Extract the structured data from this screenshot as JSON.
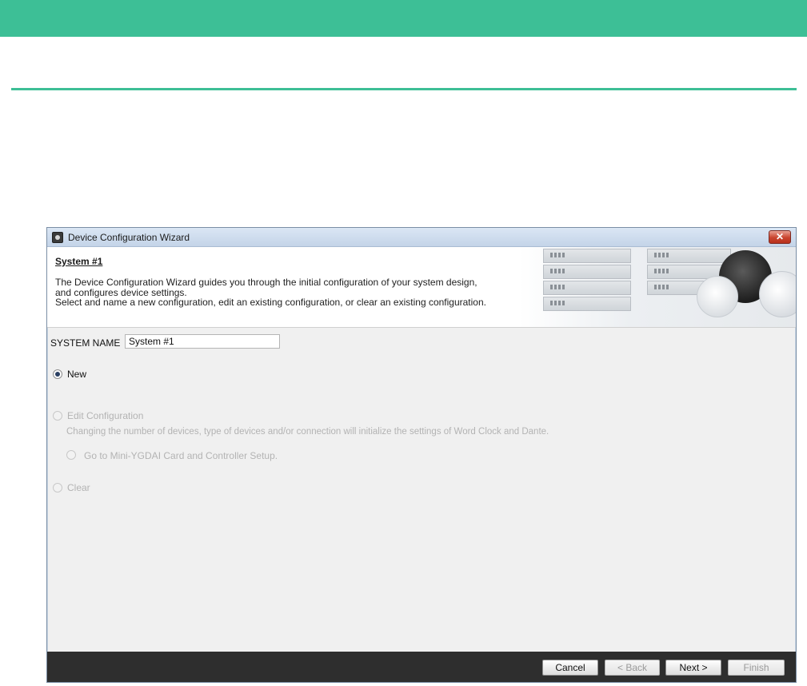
{
  "window": {
    "title": "Device Configuration Wizard"
  },
  "header": {
    "title": "System #1",
    "description_lines": [
      "The Device Configuration Wizard guides you through the initial configuration of your system design,",
      "and configures device settings.",
      "Select and name a new configuration, edit an existing configuration, or clear an existing configuration."
    ]
  },
  "system_name": {
    "label": "SYSTEM NAME",
    "value": "System #1"
  },
  "options": {
    "new": {
      "label": "New",
      "selected": true,
      "enabled": true
    },
    "edit": {
      "label": "Edit Configuration",
      "note": "Changing the number of devices, type of devices and/or connection will initialize the settings of Word Clock and Dante.",
      "enabled": false
    },
    "go_to_setup": {
      "label": "Go to Mini-YGDAI Card and Controller Setup.",
      "enabled": false
    },
    "clear": {
      "label": "Clear",
      "enabled": false
    }
  },
  "footer": {
    "cancel": "Cancel",
    "back": "< Back",
    "next": "Next >",
    "finish": "Finish"
  },
  "colors": {
    "accent": "#3dbf96",
    "footer_bg": "#2e2e2e"
  }
}
